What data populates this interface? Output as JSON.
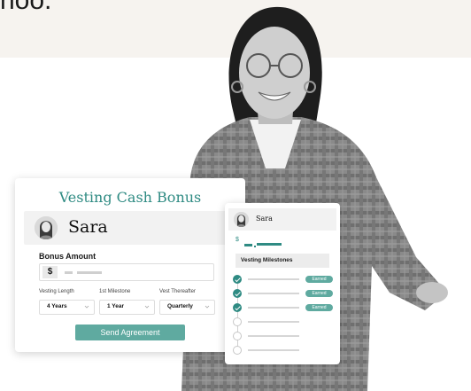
{
  "header": {
    "headline_fragment": "hoo."
  },
  "main_card": {
    "title": "Vesting Cash Bonus",
    "employee_name": "Sara",
    "bonus_amount_label": "Bonus Amount",
    "currency_symbol": "$",
    "fields": [
      {
        "label": "Vesting Length",
        "value": "4 Years"
      },
      {
        "label": "1st Milestone",
        "value": "1 Year"
      },
      {
        "label": "Vest Thereafter",
        "value": "Quarterly"
      }
    ],
    "send_button": "Send Agreement"
  },
  "side_card": {
    "employee_name": "Sara",
    "currency_symbol": "$",
    "milestones_title": "Vesting Milestones",
    "milestones": [
      {
        "status": "Earned",
        "done": true
      },
      {
        "status": "Earned",
        "done": true
      },
      {
        "status": "Earned",
        "done": true
      },
      {
        "status": "",
        "done": false
      },
      {
        "status": "",
        "done": false
      },
      {
        "status": "",
        "done": false
      }
    ]
  },
  "colors": {
    "accent": "#2f8b83",
    "button": "#5faaa0",
    "band": "#f6f3ef"
  }
}
